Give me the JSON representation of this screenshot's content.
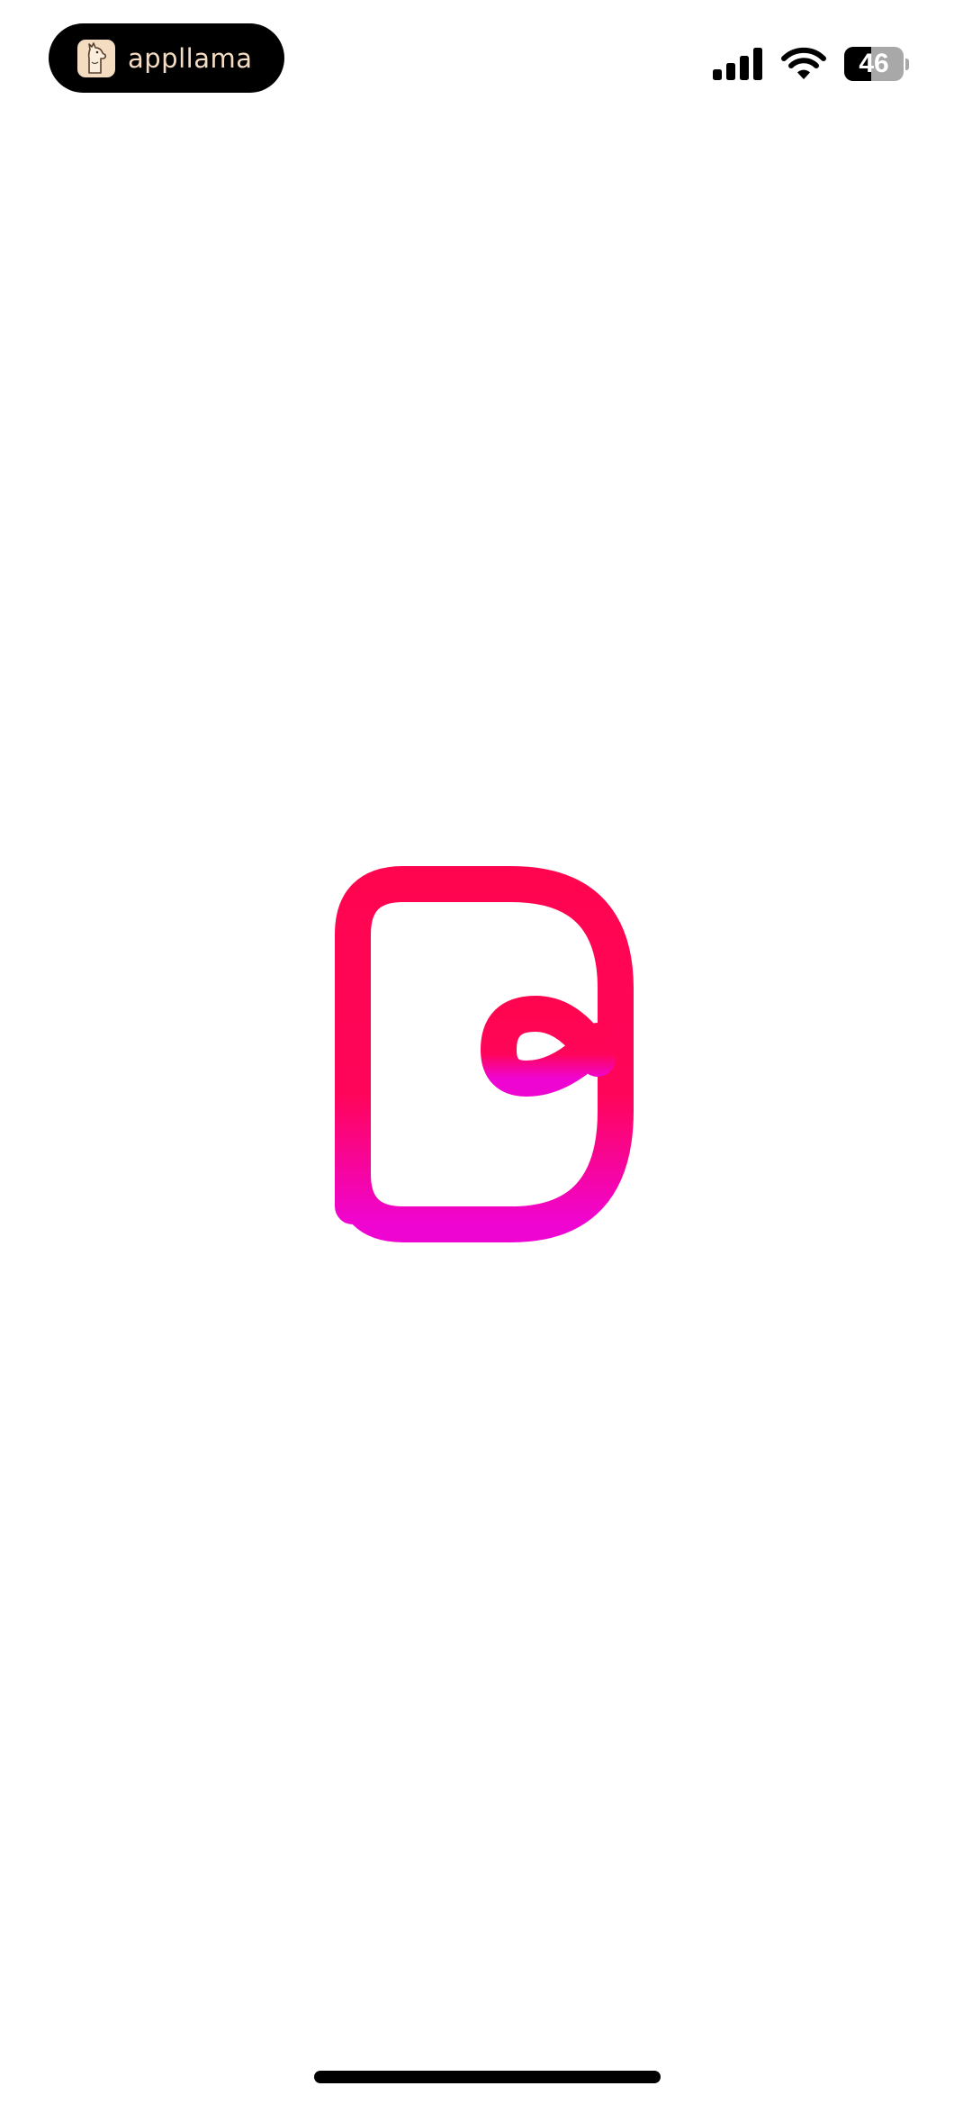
{
  "status_bar": {
    "app_pill": {
      "label": "appllama",
      "icon": "llama-icon"
    },
    "signal_icon": "cellular-signal-icon",
    "wifi_icon": "wifi-icon",
    "battery": {
      "level_text": "46",
      "level": 0.46
    }
  },
  "splash": {
    "logo_icon": "bazaart-b-logo-icon",
    "gradient": {
      "top": "#ff0550",
      "bottom": "#ef05d2"
    }
  },
  "home_indicator_icon": "home-indicator"
}
